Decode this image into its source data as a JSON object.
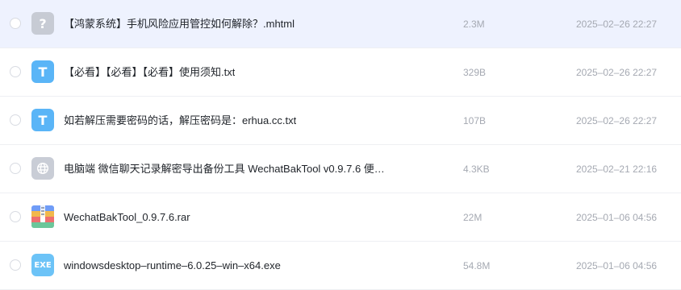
{
  "files": [
    {
      "name": "【鸿蒙系统】手机风险应用管控如何解除？.mhtml",
      "size": "2.3M",
      "date": "2025–02–26 22:27",
      "icon": "unknown-file-icon",
      "selected": true
    },
    {
      "name": "【必看】【必看】【必看】使用须知.txt",
      "size": "329B",
      "date": "2025–02–26 22:27",
      "icon": "txt-file-icon",
      "selected": false
    },
    {
      "name": "如若解压需要密码的话，解压密码是：erhua.cc.txt",
      "size": "107B",
      "date": "2025–02–26 22:27",
      "icon": "txt-file-icon",
      "selected": false
    },
    {
      "name": "电脑端 微信聊天记录解密导出备份工具 WechatBakTool v0.9.7.6 便…",
      "size": "4.3KB",
      "date": "2025–02–21 22:16",
      "icon": "web-link-icon",
      "selected": false
    },
    {
      "name": "WechatBakTool_0.9.7.6.rar",
      "size": "22M",
      "date": "2025–01–06 04:56",
      "icon": "rar-archive-icon",
      "selected": false
    },
    {
      "name": "windowsdesktop–runtime–6.0.25–win–x64.exe",
      "size": "54.8M",
      "date": "2025–01–06 04:56",
      "icon": "exe-file-icon",
      "selected": false
    }
  ],
  "icon_glyphs": {
    "unknown": "?",
    "txt": "T",
    "exe": "EXE"
  },
  "colors": {
    "selected_row": "#eef2fe",
    "meta_text": "#a5a9b2",
    "name_text": "#1f2329"
  }
}
